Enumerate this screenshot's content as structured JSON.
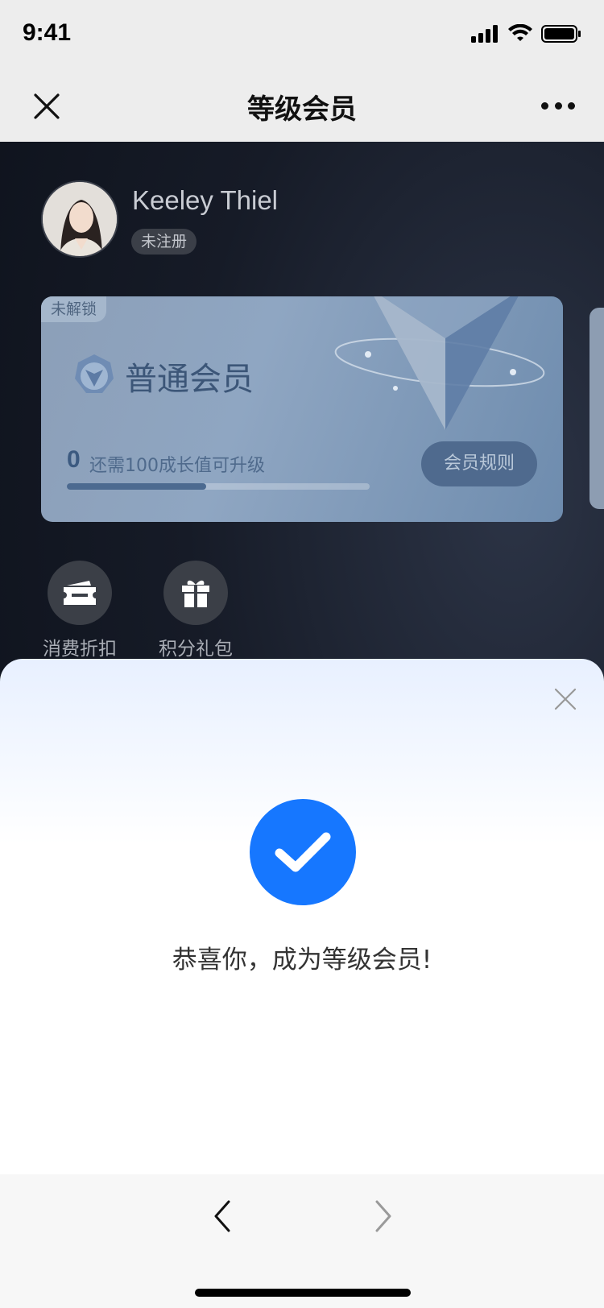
{
  "status_bar": {
    "time": "9:41"
  },
  "nav": {
    "title": "等级会员"
  },
  "user": {
    "name": "Keeley Thiel",
    "status_badge": "未注册"
  },
  "member_card": {
    "lock_tag": "未解锁",
    "level_name": "普通会员",
    "growth_value": "0",
    "growth_hint": "还需100成长值可升级",
    "progress_fraction": 0.46,
    "rules_button": "会员规则"
  },
  "benefits": [
    {
      "label": "消费折扣",
      "icon": "ticket-icon"
    },
    {
      "label": "积分礼包",
      "icon": "gift-icon"
    }
  ],
  "sheet": {
    "message": "恭喜你，成为等级会员!"
  },
  "colors": {
    "accent": "#1677ff",
    "card": "#8fa6c2",
    "page_bg": "#0b0f18"
  }
}
